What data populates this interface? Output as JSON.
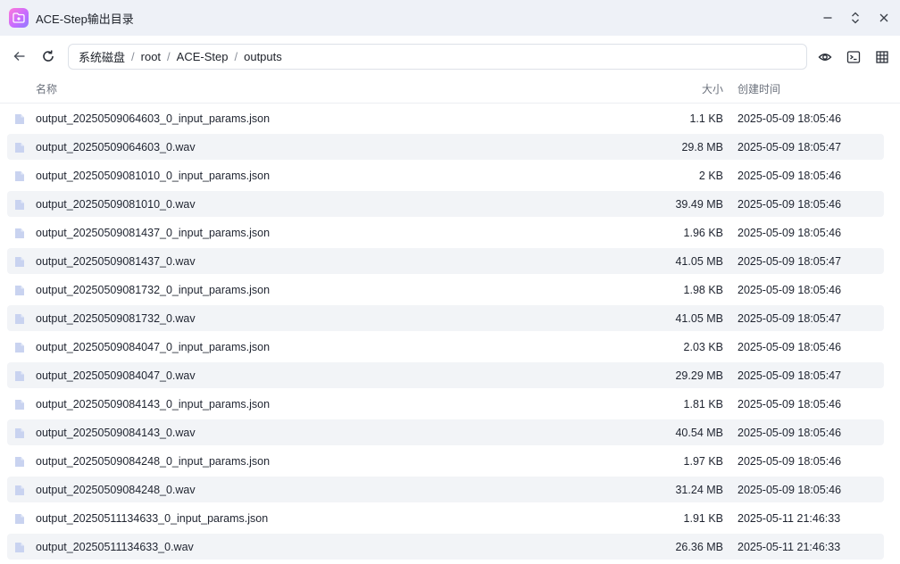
{
  "window": {
    "title": "ACE-Step输出目录",
    "icons": {
      "app": "folder-music-icon",
      "minimize": "minimize-icon",
      "maximize": "maximize-icon",
      "close": "close-icon"
    }
  },
  "toolbar": {
    "icons": {
      "back": "back-arrow-icon",
      "refresh": "refresh-icon",
      "preview": "eye-icon",
      "terminal": "terminal-icon",
      "view": "grid-view-icon"
    }
  },
  "breadcrumb": [
    "系统磁盘",
    "root",
    "ACE-Step",
    "outputs"
  ],
  "columns": {
    "name": "名称",
    "size": "大小",
    "created": "创建时间"
  },
  "colors": {
    "titlebar": "#eef1f7",
    "row_alt": "#f2f4f7",
    "file_icon": "#c9d3f0"
  },
  "files": [
    {
      "name": "output_20250509064603_0_input_params.json",
      "size": "1.1 KB",
      "created": "2025-05-09 18:05:46"
    },
    {
      "name": "output_20250509064603_0.wav",
      "size": "29.8 MB",
      "created": "2025-05-09 18:05:47"
    },
    {
      "name": "output_20250509081010_0_input_params.json",
      "size": "2 KB",
      "created": "2025-05-09 18:05:46"
    },
    {
      "name": "output_20250509081010_0.wav",
      "size": "39.49 MB",
      "created": "2025-05-09 18:05:46"
    },
    {
      "name": "output_20250509081437_0_input_params.json",
      "size": "1.96 KB",
      "created": "2025-05-09 18:05:46"
    },
    {
      "name": "output_20250509081437_0.wav",
      "size": "41.05 MB",
      "created": "2025-05-09 18:05:47"
    },
    {
      "name": "output_20250509081732_0_input_params.json",
      "size": "1.98 KB",
      "created": "2025-05-09 18:05:46"
    },
    {
      "name": "output_20250509081732_0.wav",
      "size": "41.05 MB",
      "created": "2025-05-09 18:05:47"
    },
    {
      "name": "output_20250509084047_0_input_params.json",
      "size": "2.03 KB",
      "created": "2025-05-09 18:05:46"
    },
    {
      "name": "output_20250509084047_0.wav",
      "size": "29.29 MB",
      "created": "2025-05-09 18:05:47"
    },
    {
      "name": "output_20250509084143_0_input_params.json",
      "size": "1.81 KB",
      "created": "2025-05-09 18:05:46"
    },
    {
      "name": "output_20250509084143_0.wav",
      "size": "40.54 MB",
      "created": "2025-05-09 18:05:46"
    },
    {
      "name": "output_20250509084248_0_input_params.json",
      "size": "1.97 KB",
      "created": "2025-05-09 18:05:46"
    },
    {
      "name": "output_20250509084248_0.wav",
      "size": "31.24 MB",
      "created": "2025-05-09 18:05:46"
    },
    {
      "name": "output_20250511134633_0_input_params.json",
      "size": "1.91 KB",
      "created": "2025-05-11 21:46:33"
    },
    {
      "name": "output_20250511134633_0.wav",
      "size": "26.36 MB",
      "created": "2025-05-11 21:46:33"
    }
  ]
}
